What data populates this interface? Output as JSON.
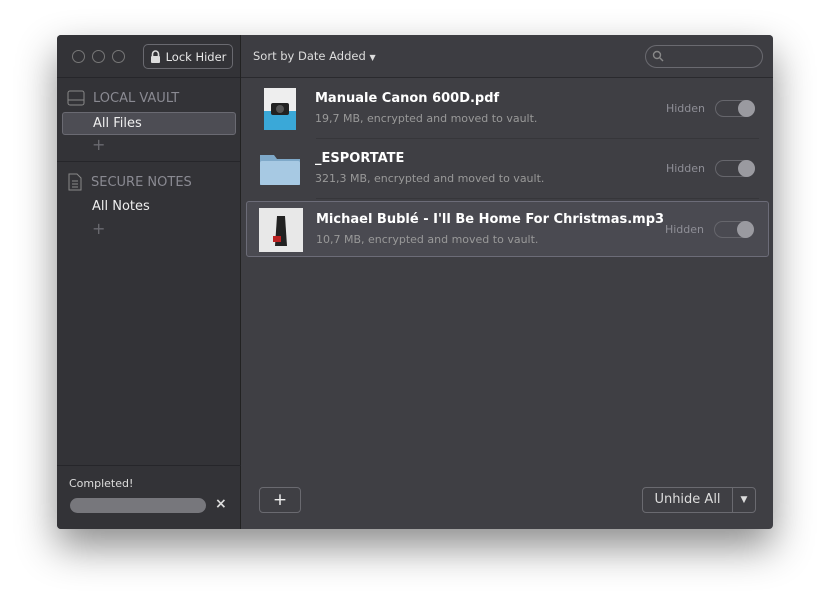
{
  "toolbar": {
    "lock_label": "Lock Hider",
    "sort_label": "Sort by Date Added",
    "search_placeholder": ""
  },
  "sidebar": {
    "sections": [
      {
        "title": "LOCAL VAULT",
        "items": [
          {
            "label": "All Files",
            "selected": true
          }
        ]
      },
      {
        "title": "SECURE NOTES",
        "items": [
          {
            "label": "All Notes",
            "selected": false
          }
        ]
      }
    ],
    "add_label": "+",
    "status": {
      "text": "Completed!",
      "progress": 1.0,
      "close_label": "×"
    }
  },
  "files": [
    {
      "name": "Manuale Canon 600D.pdf",
      "meta": "19,7 MB, encrypted and moved to vault.",
      "status": "Hidden",
      "hidden": true,
      "icon": "pdf-thumbnail"
    },
    {
      "name": "_ESPORTATE",
      "meta": "321,3 MB, encrypted and moved to vault.",
      "status": "Hidden",
      "hidden": true,
      "icon": "folder-icon"
    },
    {
      "name": "Michael Bublé - I'll Be Home For Christmas.mp3",
      "meta": "10,7 MB, encrypted and moved to vault.",
      "status": "Hidden",
      "hidden": true,
      "icon": "album-art"
    }
  ],
  "footer": {
    "add_label": "+",
    "unhide_label": "Unhide All",
    "menu_arrow": "▼"
  }
}
